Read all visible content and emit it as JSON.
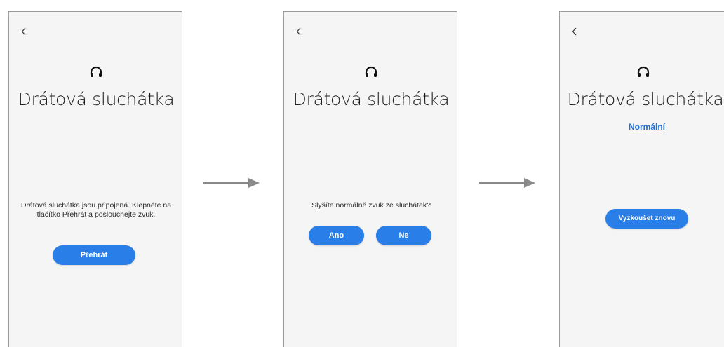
{
  "screens": [
    {
      "back_icon": "chevron-left-icon",
      "header_icon": "headphones-icon",
      "title": "Drátová sluchátka",
      "message": "Drátová sluchátka jsou připojená. Klepněte na tlačítko Přehrát a poslouchejte zvuk.",
      "play_button": "Přehrát"
    },
    {
      "back_icon": "chevron-left-icon",
      "header_icon": "headphones-icon",
      "title": "Drátová sluchátka",
      "message": "Slyšíte normálně zvuk ze sluchátek?",
      "yes_button": "Ano",
      "no_button": "Ne"
    },
    {
      "back_icon": "chevron-left-icon",
      "header_icon": "headphones-icon",
      "title": "Drátová sluchátka",
      "result": "Normální",
      "retry_button": "Vyzkoušet znovu"
    }
  ],
  "flow_arrow_icon": "arrow-right-icon",
  "colors": {
    "accent": "#2a7ee8",
    "result_text": "#1f6fd6",
    "screen_bg": "#f5f5f5",
    "arrow": "#8a8a8a"
  }
}
